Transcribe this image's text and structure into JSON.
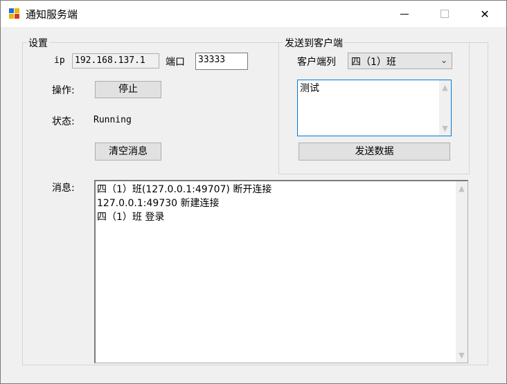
{
  "window": {
    "title": "通知服务端",
    "minimize_icon": "minimize-icon",
    "maximize_icon": "maximize-icon",
    "close_icon": "close-icon"
  },
  "settings": {
    "group_label": "设置",
    "ip_label": "ip",
    "ip_value": "192.168.137.1",
    "port_label": "端口",
    "port_value": "33333",
    "operation_label": "操作:",
    "stop_button": "停止",
    "status_label": "状态:",
    "status_value": "Running",
    "clear_button": "清空消息"
  },
  "send": {
    "group_label": "发送到客户端",
    "client_label": "客户端列",
    "client_selected": "四（1）班",
    "message_text": "测试",
    "send_button": "发送数据"
  },
  "messages": {
    "label": "消息:",
    "lines": [
      "四（1）班(127.0.0.1:49707) 断开连接",
      "127.0.0.1:49730 新建连接",
      "四（1）班 登录"
    ]
  }
}
